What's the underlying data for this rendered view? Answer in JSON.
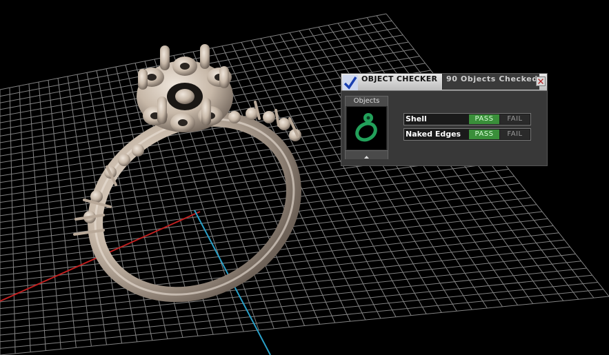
{
  "viewport": {
    "background": "#000000",
    "grid_color": "#9a9a9a",
    "x_axis_color": "#c02020",
    "y_axis_color": "#2aa0c8",
    "model_color": "#c7b8a8",
    "model_icon": "ring-model"
  },
  "checker": {
    "title": "OBJECT CHECKER",
    "count_text": "90  Objects Checked",
    "objects_label": "Objects",
    "rows": [
      {
        "label": "Shell",
        "pass": "PASS",
        "fail": "FAIL",
        "status": "pass"
      },
      {
        "label": "Naked Edges",
        "pass": "PASS",
        "fail": "FAIL",
        "status": "pass"
      }
    ],
    "pass_color": "#3a8f3a",
    "thumb_color": "#22a05a"
  }
}
